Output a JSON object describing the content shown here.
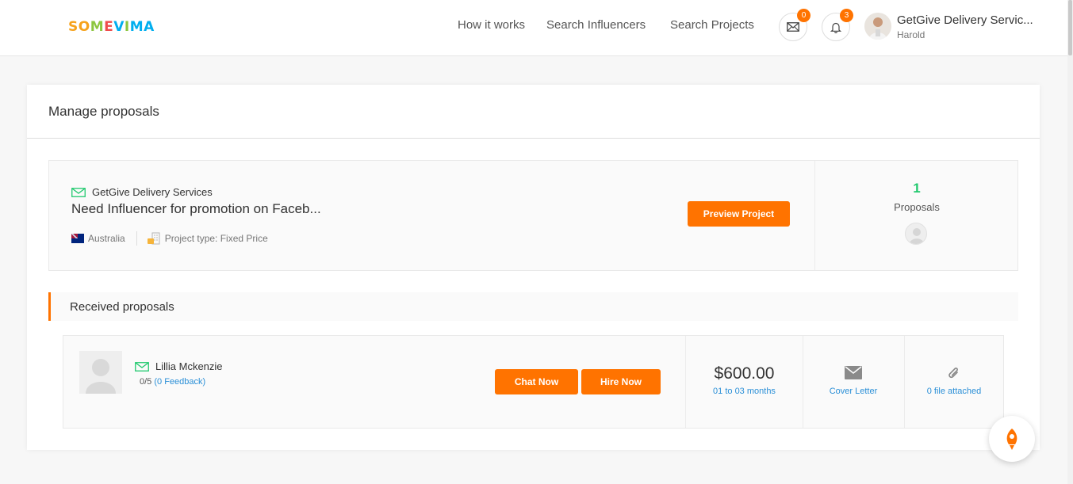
{
  "header": {
    "logo_letters": [
      {
        "char": "S",
        "color": "#f6a21b"
      },
      {
        "char": "O",
        "color": "#f6a21b"
      },
      {
        "char": "M",
        "color": "#8cc63f"
      },
      {
        "char": "E",
        "color": "#ef4b4b"
      },
      {
        "char": "V",
        "color": "#00aeef"
      },
      {
        "char": "I",
        "color": "#8cc63f"
      },
      {
        "char": "M",
        "color": "#00aeef"
      },
      {
        "char": "A",
        "color": "#00aeef"
      }
    ],
    "nav": [
      "How it works",
      "Search Influencers",
      "Search Projects"
    ],
    "messages_count": "0",
    "notifications_count": "3",
    "user_name": "GetGive Delivery Servic...",
    "user_sub": "Harold"
  },
  "main": {
    "title": "Manage proposals",
    "project": {
      "company": "GetGive Delivery Services",
      "title": "Need Influencer for promotion on Faceb...",
      "country": "Australia",
      "project_type": "Project type: Fixed Price",
      "preview_button": "Preview Project",
      "proposals_count": "1",
      "proposals_label": "Proposals"
    },
    "received_title": "Received proposals",
    "proposal": {
      "name": "Lillia Mckenzie",
      "rating": "0/5",
      "feedback": "(0 Feedback)",
      "chat_button": "Chat Now",
      "hire_button": "Hire Now",
      "price": "$600.00",
      "duration": "01 to 03 months",
      "cover_letter": "Cover Letter",
      "files": "0 file attached"
    }
  },
  "colors": {
    "accent": "#ff7300",
    "success": "#21c96e",
    "link": "#2a8fd7"
  },
  "icons": [
    "mail-icon",
    "bell-icon",
    "envelope-verified-icon",
    "flag-australia-icon",
    "project-type-icon",
    "envelope-icon",
    "paperclip-icon",
    "rocket-icon"
  ]
}
